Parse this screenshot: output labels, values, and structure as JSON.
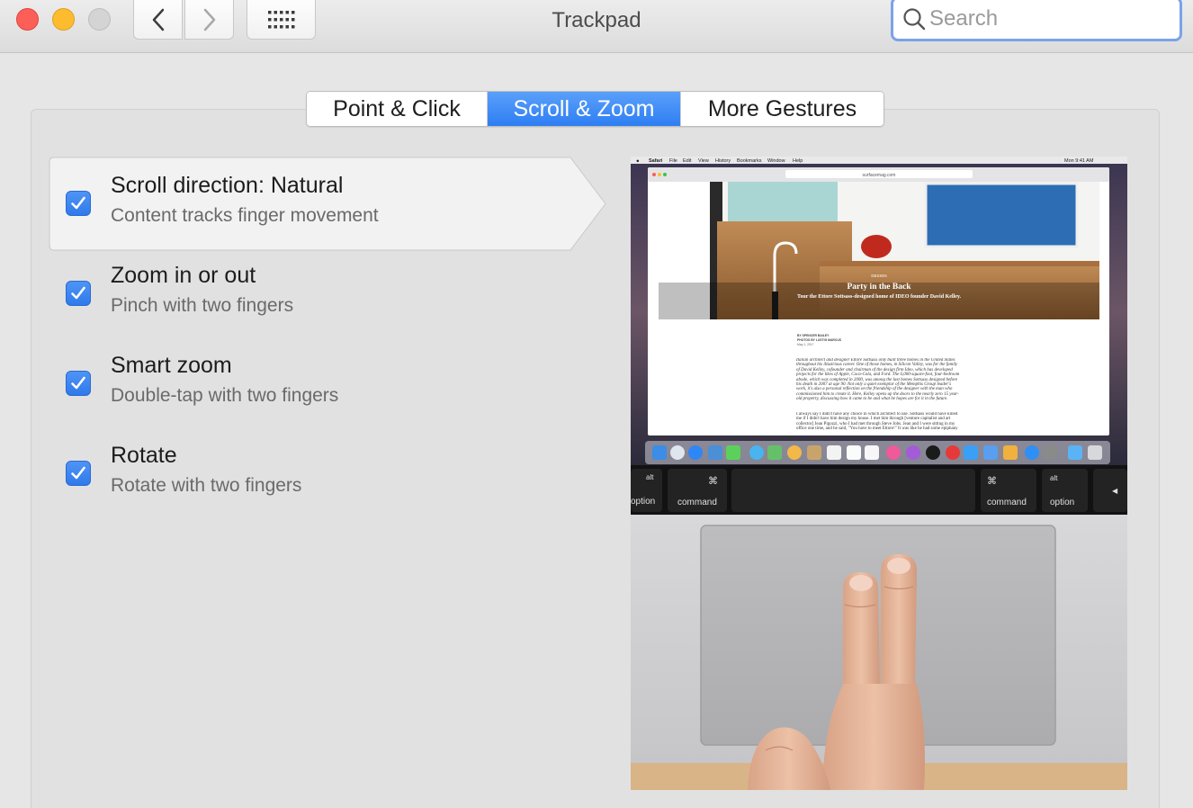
{
  "window": {
    "title": "Trackpad",
    "search_placeholder": "Search"
  },
  "tabs": [
    {
      "label": "Point & Click",
      "active": false
    },
    {
      "label": "Scroll & Zoom",
      "active": true
    },
    {
      "label": "More Gestures",
      "active": false
    }
  ],
  "options": [
    {
      "title": "Scroll direction: Natural",
      "description": "Content tracks finger movement",
      "checked": true,
      "selected": true
    },
    {
      "title": "Zoom in or out",
      "description": "Pinch with two fingers",
      "checked": true,
      "selected": false
    },
    {
      "title": "Smart zoom",
      "description": "Double-tap with two fingers",
      "checked": true,
      "selected": false
    },
    {
      "title": "Rotate",
      "description": "Rotate with two fingers",
      "checked": true,
      "selected": false
    }
  ],
  "preview": {
    "menubar": {
      "app": "Safari",
      "menus": [
        "File",
        "Edit",
        "View",
        "History",
        "Bookmarks",
        "Window",
        "Help"
      ],
      "clock": "Mon 9:41 AM"
    },
    "browser": {
      "url": "surfacemag.com"
    },
    "article": {
      "category": "DESIGN",
      "headline": "Party in the Back",
      "subheadline": "Tour the Ettore Sottsass-designed home of IDEO founder David Kelley.",
      "byline": "BY SPENCER BAILEY",
      "photo_credit": "PHOTOS BY LUSTIG MARCUS",
      "date": "May 1, 2017",
      "body_1": "Italian architect and designer Ettore Sottsass only built three homes in the United States throughout his illustrious career. One of those homes, in Silicon Valley, was for the family of David Kelley, cofounder and chairman of the design firm Ideo, which has developed projects for the likes of Apple, Coca-Cola, and Ford. The 6,000-square-foot, four-bedroom abode, which was completed in 2000, was among the last homes Sottsass designed before his death in 2007 at age 90. Not only a quiet exemplar of the Memphis Group leader's work, it's also a personal reflection on the friendship of the designer with the man who commissioned him to create it. Here, Kelley opens up the doors to the nearly zero 15 year-old property, discussing how it came to be and what he hopes are for it in the future.",
      "body_2": "I always say I didn't have any choice in which architect to use. Sottsass would have killed me if I didn't have him design my house. I met him through [venture capitalist and art collector] Jean Pigozzi, who I had met through Steve Jobs. Jean and I were sitting in my office one time, and he said, \"You have to meet Ettore!\" It was like he had some epiphany"
    },
    "keys": {
      "left_alt": "alt",
      "left_option": "option",
      "left_cmd_symbol": "⌘",
      "left_command": "command",
      "right_cmd_symbol": "⌘",
      "right_command": "command",
      "right_alt": "alt",
      "right_option": "option",
      "arrow": "◀"
    }
  }
}
